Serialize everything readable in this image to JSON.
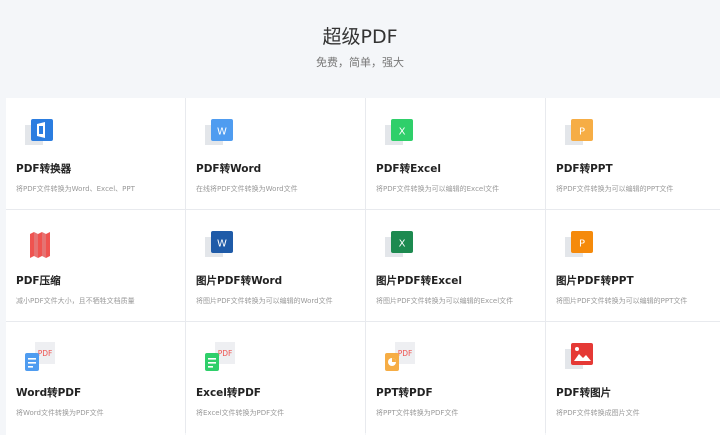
{
  "header": {
    "title": "超级PDF",
    "subtitle": "免费，简单，强大"
  },
  "tools": [
    {
      "title": "PDF转换器",
      "desc": "将PDF文件转换为Word、Excel、PPT",
      "icon": "office-icon",
      "color": "#2b7de0"
    },
    {
      "title": "PDF转Word",
      "desc": "在线将PDF文件转换为Word文件",
      "icon": "word-icon",
      "color": "#4f9cf0"
    },
    {
      "title": "PDF转Excel",
      "desc": "将PDF文件转换为可以编辑的Excel文件",
      "icon": "excel-icon",
      "color": "#2fcf6a"
    },
    {
      "title": "PDF转PPT",
      "desc": "将PDF文件转换为可以编辑的PPT文件",
      "icon": "ppt-icon",
      "color": "#f6ad45"
    },
    {
      "title": "PDF压缩",
      "desc": "减小PDF文件大小，且不牺牲文档质量",
      "icon": "compress-icon",
      "color": "#ef5350"
    },
    {
      "title": "图片PDF转Word",
      "desc": "将图片PDF文件转换为可以编辑的Word文件",
      "icon": "word-icon",
      "color": "#1f5ba8"
    },
    {
      "title": "图片PDF转Excel",
      "desc": "将图片PDF文件转换为可以编辑的Excel文件",
      "icon": "excel-icon",
      "color": "#1d8a50"
    },
    {
      "title": "图片PDF转PPT",
      "desc": "将图片PDF文件转换为可以编辑的PPT文件",
      "icon": "ppt-icon",
      "color": "#f58a0b"
    },
    {
      "title": "Word转PDF",
      "desc": "将Word文件转换为PDF文件",
      "icon": "word-to-pdf-icon",
      "color": "#4f9cf0"
    },
    {
      "title": "Excel转PDF",
      "desc": "将Excel文件转换为PDF文件",
      "icon": "excel-to-pdf-icon",
      "color": "#2fcf6a"
    },
    {
      "title": "PPT转PDF",
      "desc": "将PPT文件转换为PDF文件",
      "icon": "ppt-to-pdf-icon",
      "color": "#f6ad45"
    },
    {
      "title": "PDF转图片",
      "desc": "将PDF文件转换成图片文件",
      "icon": "pdf-to-image-icon",
      "color": "#e53935"
    }
  ],
  "icon_labels": {
    "word": "W",
    "excel": "X",
    "ppt": "P",
    "pdf": "PDF"
  }
}
